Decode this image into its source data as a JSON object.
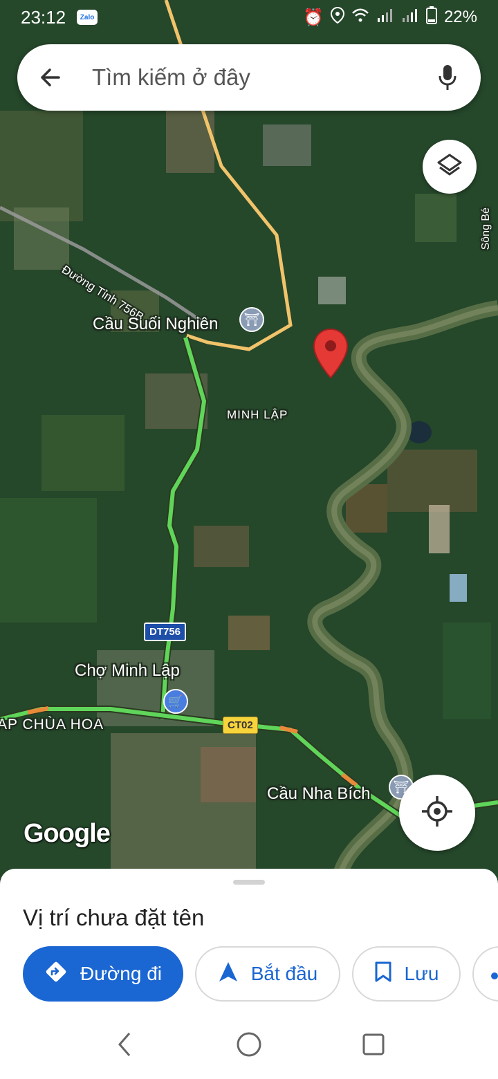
{
  "status_bar": {
    "time": "23:12",
    "app_badge": "Zalo",
    "battery": "22%",
    "icons": [
      "alarm-icon",
      "location-icon",
      "wifi-icon",
      "signal-icon",
      "signal-icon",
      "battery-icon"
    ]
  },
  "search": {
    "placeholder": "Tìm kiếm ở đây",
    "back_icon": "arrow-left-icon",
    "mic_icon": "mic-icon"
  },
  "map": {
    "labels": {
      "song_be": "Sông Bé",
      "duong_tinh": "Đường Tỉnh 756B",
      "cau_suoi_nghien": "Cầu Suối Nghiên",
      "minh_lap": "MINH LẬP",
      "cho_minh_lap": "Chợ Minh Lập",
      "ap_chua_hoa": "AP CHÙA HOA",
      "cau_nha_bich": "Cầu Nha Bích"
    },
    "shields": {
      "dt756": "DT756",
      "ct02": "CT02"
    },
    "logo": "Google",
    "colors": {
      "traffic_green": "#5fd55a",
      "traffic_orange": "#e88a3a",
      "road_yellow": "#e7b85a",
      "pin_red": "#e53935"
    }
  },
  "controls": {
    "layers_icon": "layers-icon",
    "locate_icon": "my-location-icon"
  },
  "sheet": {
    "title": "Vị trí chưa đặt tên",
    "actions": {
      "directions": "Đường đi",
      "start": "Bắt đầu",
      "save": "Lưu"
    },
    "accent": "#1a66d2"
  },
  "nav": {
    "back_icon": "nav-back-icon",
    "home_icon": "nav-home-icon",
    "recent_icon": "nav-recent-icon"
  }
}
